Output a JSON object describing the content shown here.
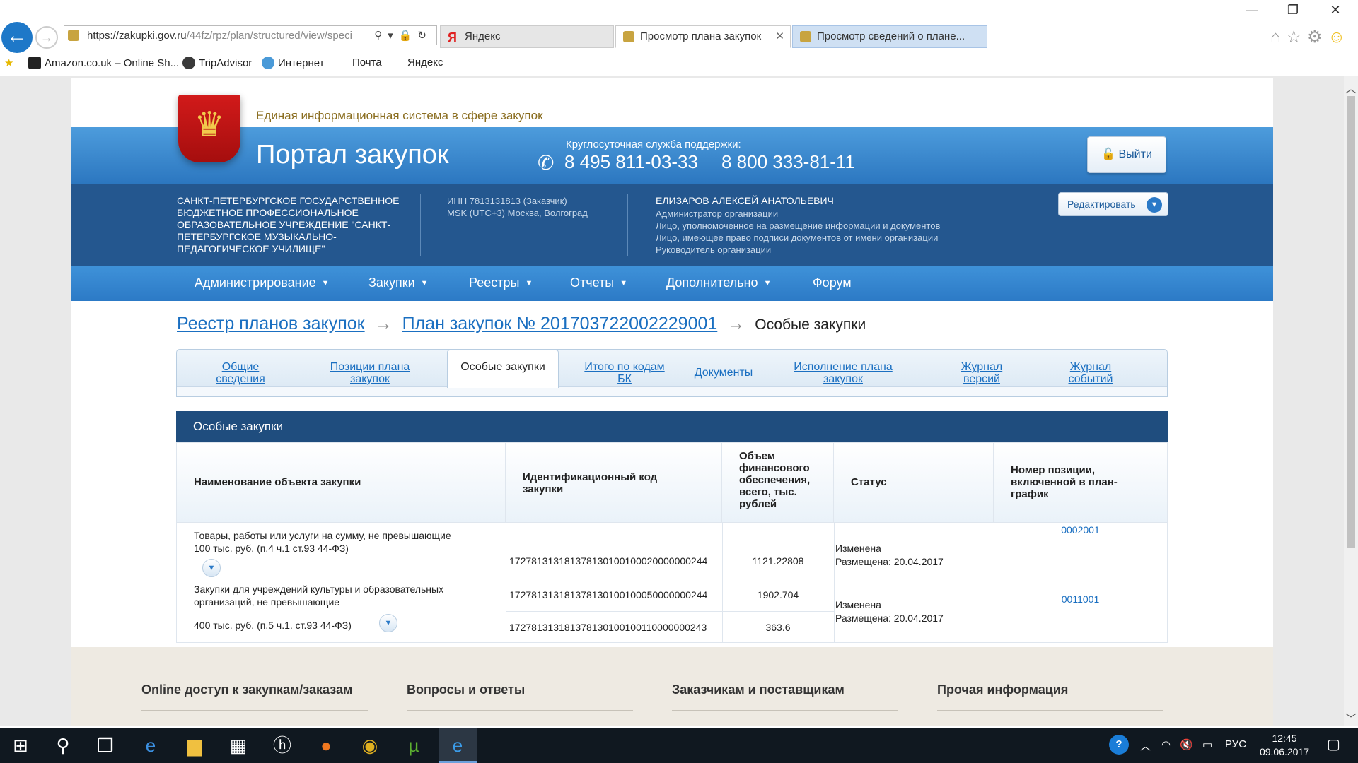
{
  "browser": {
    "url_main": "https://zakupki.gov.ru",
    "url_rest": "/44fz/rpz/plan/structured/view/speci",
    "tabs": [
      {
        "label": "Яндекс"
      },
      {
        "label": "Просмотр плана закупок"
      },
      {
        "label": "Просмотр сведений о плане..."
      }
    ],
    "tab_close": "✕",
    "favorites": [
      {
        "label": "Amazon.co.uk – Online Sh..."
      },
      {
        "label": "TripAdvisor"
      },
      {
        "label": "Интернет"
      },
      {
        "label": "Почта"
      },
      {
        "label": "Яндекс"
      }
    ]
  },
  "site": {
    "subtitle": "Единая информационная система в сфере закупок",
    "title": "Портал закупок",
    "support_label": "Круглосуточная служба поддержки:",
    "phone1": "8 495 811-03-33",
    "phone2": "8 800 333-81-11",
    "logout_label": "Выйти"
  },
  "org": {
    "name": "САНКТ-ПЕТЕРБУРГСКОЕ ГОСУДАРСТВЕННОЕ БЮДЖЕТНОЕ ПРОФЕССИОНАЛЬНОЕ ОБРАЗОВАТЕЛЬНОЕ УЧРЕЖДЕНИЕ \"САНКТ-ПЕТЕРБУРГСКОЕ МУЗЫКАЛЬНО-ПЕДАГОГИЧЕСКОЕ УЧИЛИЩЕ\"",
    "inn": "ИНН 7813131813 (Заказчик)",
    "timezone": "MSK (UTC+3) Москва, Волгоград",
    "user_name": "ЕЛИЗАРОВ АЛЕКСЕЙ АНАТОЛЬЕВИЧ",
    "roles": [
      "Администратор организации",
      "Лицо, уполномоченное на размещение информации и документов",
      "Лицо, имеющее право подписи документов от имени организации",
      "Руководитель организации"
    ],
    "edit_label": "Редактировать"
  },
  "main_nav": [
    {
      "label": "Администрирование"
    },
    {
      "label": "Закупки"
    },
    {
      "label": "Реестры"
    },
    {
      "label": "Отчеты"
    },
    {
      "label": "Дополнительно"
    },
    {
      "label": "Форум"
    }
  ],
  "breadcrumb": {
    "link1": "Реестр планов закупок",
    "link2": "План закупок № 201703722002229001",
    "current": "Особые закупки",
    "separator": "→"
  },
  "plan_tabs": [
    {
      "label": "Общие сведения"
    },
    {
      "label": "Позиции плана закупок"
    },
    {
      "label": "Особые закупки"
    },
    {
      "label": "Итого по кодам БК"
    },
    {
      "label": "Документы"
    },
    {
      "label": "Исполнение плана закупок"
    },
    {
      "label": "Журнал версий"
    },
    {
      "label": "Журнал событий"
    }
  ],
  "section_title": "Особые закупки",
  "table": {
    "headers": [
      "Наименование объекта закупки",
      "Идентификационный код закупки",
      "Объем финансового обеспечения, всего, тыс. рублей",
      "Статус",
      "Номер позиции, включенной в план-график"
    ],
    "rows": [
      {
        "name": "Товары, работы или услуги на сумму, не превышающие 100 тыс. руб. (п.4 ч.1 ст.93 44-ФЗ)",
        "codes": [
          "172781313181378130100100020000000244"
        ],
        "amounts": [
          "1121.22808"
        ],
        "status": "Изменена",
        "published": "Размещена: 20.04.2017",
        "position": "0002001"
      },
      {
        "name_line1": "Закупки для учреждений культуры и образовательных организаций, не превышающие",
        "name_line2": "400 тыс. руб. (п.5 ч.1. ст.93 44-ФЗ)",
        "codes": [
          "172781313181378130100100050000000244",
          "172781313181378130100100110000000243"
        ],
        "amounts": [
          "1902.704",
          "363.6"
        ],
        "status": "Изменена",
        "published": "Размещена: 20.04.2017",
        "position": "0011001"
      }
    ]
  },
  "footer": [
    {
      "label": "Online доступ к закупкам/заказам"
    },
    {
      "label": "Вопросы и ответы"
    },
    {
      "label": "Заказчикам и поставщикам"
    },
    {
      "label": "Прочая информация"
    }
  ],
  "taskbar": {
    "lang": "РУС",
    "time": "12:45",
    "date": "09.06.2017"
  },
  "icons": {
    "back": "←",
    "forward": "→",
    "search": "⚲",
    "lock": "🔒",
    "refresh": "↻",
    "home": "⌂",
    "star": "☆",
    "gear": "⚙",
    "smiley": "☺",
    "phone": "✆",
    "caret": "▼",
    "expand": "▼",
    "eagle": "♛"
  }
}
